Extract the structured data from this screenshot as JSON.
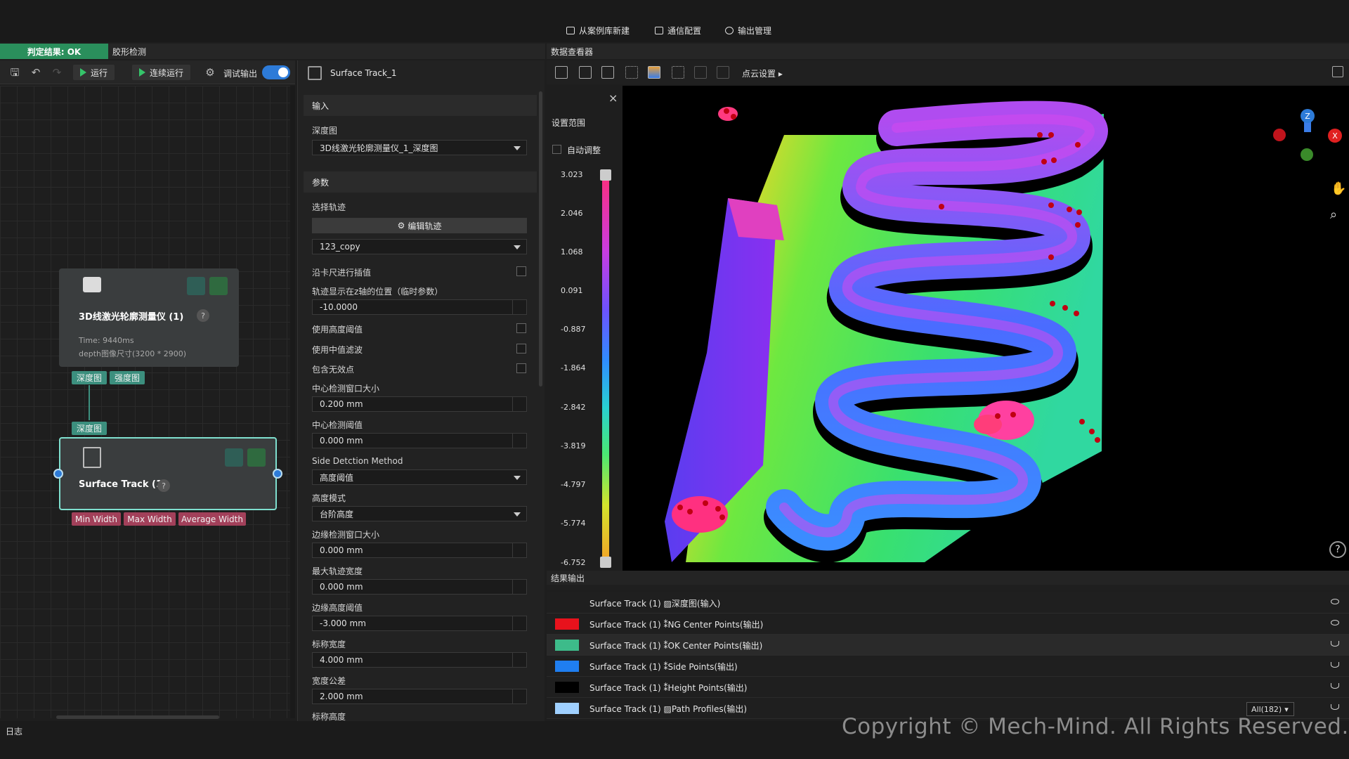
{
  "topbar": {
    "buttons": [
      "从案例库新建",
      "通信配置",
      "输出管理"
    ]
  },
  "left_tabs": {
    "result": "判定结果: OK",
    "project": "胶形检测"
  },
  "toolbar": {
    "run": "运行",
    "continuous_run": "连续运行",
    "debug_output": "调试输出",
    "debug_toggle_on": true
  },
  "nodes": {
    "laser": {
      "title": "3D线激光轮廓测量仪 (1)",
      "time": "Time: 9440ms",
      "size": "depth图像尺寸(3200 * 2900)",
      "out_pins": [
        "深度图",
        "强度图"
      ]
    },
    "surface": {
      "in_pin": "深度图",
      "title": "Surface Track (1)",
      "out_pins": [
        "Min Width",
        "Max Width",
        "Average Width"
      ]
    }
  },
  "properties": {
    "node_name": "Surface Track_1",
    "section_input": "输入",
    "depth_label": "深度图",
    "depth_value": "3D线激光轮廓测量仪_1_深度图",
    "section_params": "参数",
    "select_track_label": "选择轨迹",
    "edit_track_btn": "编辑轨迹",
    "track_value": "123_copy",
    "interp_label": "沿卡尺进行插值",
    "z_pos_label": "轨迹显示在z轴的位置（临时参数）",
    "z_pos_value": "-10.0000",
    "use_height_th_label": "使用高度阈值",
    "median_filter_label": "使用中值滤波",
    "include_invalid_label": "包含无效点",
    "center_win_label": "中心检测窗口大小",
    "center_win_value": "0.200 mm",
    "center_th_label": "中心检测阈值",
    "center_th_value": "0.000 mm",
    "side_method_label": "Side Detction Method",
    "side_method_value": "高度阈值",
    "height_mode_label": "高度模式",
    "height_mode_value": "台阶高度",
    "edge_win_label": "边缘检测窗口大小",
    "edge_win_value": "0.000 mm",
    "max_width_label": "最大轨迹宽度",
    "max_width_value": "0.000 mm",
    "edge_height_label": "边缘高度阈值",
    "edge_height_value": "-3.000 mm",
    "nominal_width_label": "标称宽度",
    "nominal_width_value": "4.000 mm",
    "width_tol_label": "宽度公差",
    "width_tol_value": "2.000 mm",
    "nominal_height_label": "标称高度"
  },
  "viewer": {
    "title": "数据查看器",
    "pointcloud_settings": "点云设置",
    "range_title": "设置范围",
    "auto_adjust": "自动调整",
    "ticks": [
      "3.023",
      "2.046",
      "1.068",
      "0.091",
      "-0.887",
      "-1.864",
      "-2.842",
      "-3.819",
      "-4.797",
      "-5.774",
      "-6.752"
    ],
    "axis": {
      "z": "Z",
      "x": "X"
    }
  },
  "results": {
    "title": "结果输出",
    "rows": [
      {
        "color": "",
        "text": "Surface Track (1) ▨深度图(输入)"
      },
      {
        "color": "#e8121c",
        "text": "Surface Track (1) ⁑NG Center Points(输出)"
      },
      {
        "color": "#3dbb8a",
        "text": "Surface Track (1) ⁑OK Center Points(输出)"
      },
      {
        "color": "#1f7ef0",
        "text": "Surface Track (1) ⁑Side Points(输出)"
      },
      {
        "color": "#000000",
        "text": "Surface Track (1) ⁑Height Points(输出)"
      },
      {
        "color": "#9fd0ff",
        "text": "Surface Track (1) ▨Path Profiles(输出)"
      }
    ],
    "filter": "All(182)"
  },
  "status": {
    "log": "日志"
  },
  "watermark": "Copyright © Mech-Mind. All Rights Reserved."
}
